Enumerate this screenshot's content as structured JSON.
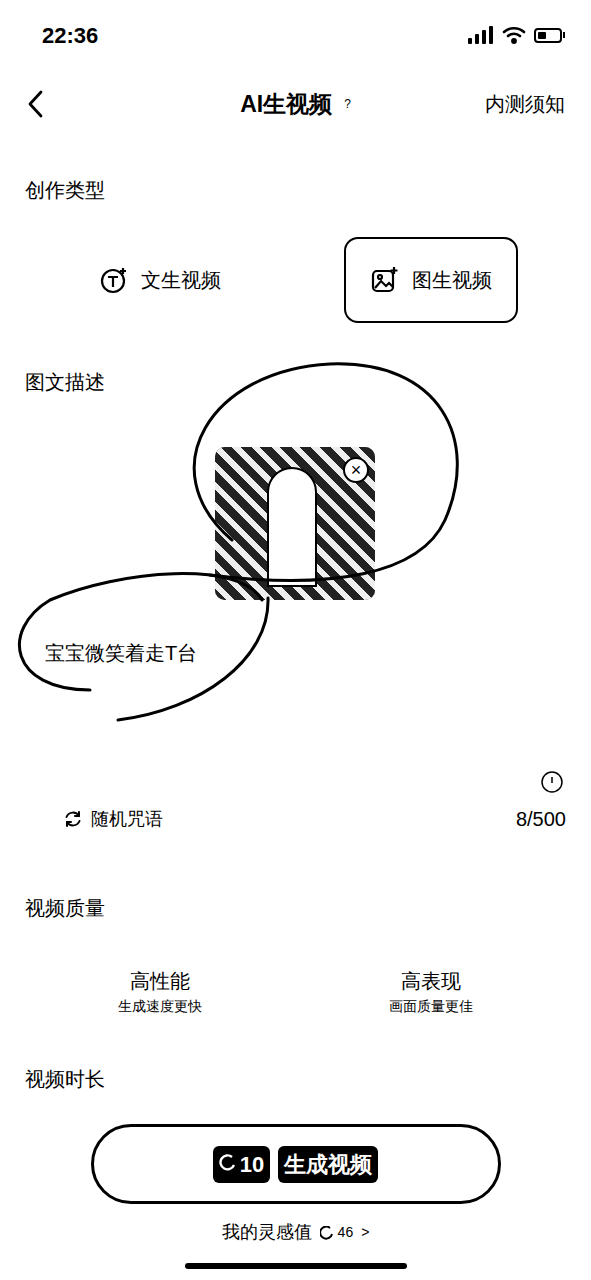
{
  "status_bar": {
    "time": "22:36",
    "battery": {
      "level": 0.4
    }
  },
  "nav": {
    "title": "AI生视频",
    "help": "?",
    "notice": "内测须知"
  },
  "creation_type": {
    "label": "创作类型",
    "tabs": [
      {
        "label": "文生视频",
        "selected": false
      },
      {
        "label": "图生视频",
        "selected": true
      }
    ]
  },
  "description": {
    "label": "图文描述",
    "image": {
      "remove": "×"
    },
    "prompt": "宝宝微笑着走T台",
    "random": "随机咒语",
    "count": "8/500"
  },
  "quality": {
    "label": "视频质量",
    "options": [
      {
        "title": "高性能",
        "subtitle": "生成速度更快"
      },
      {
        "title": "高表现",
        "subtitle": "画面质量更佳"
      }
    ]
  },
  "duration": {
    "label": "视频时长"
  },
  "generate": {
    "cost": "10",
    "label": "生成视频"
  },
  "inspiration": {
    "label": "我的灵感值",
    "value": "46",
    "chevron": ">"
  }
}
